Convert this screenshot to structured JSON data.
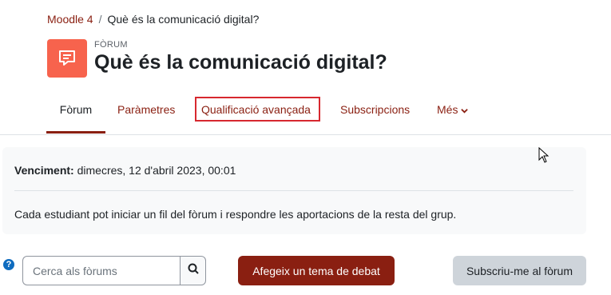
{
  "breadcrumb": {
    "home": "Moodle 4",
    "separator": "/",
    "current": "Què és la comunicació digital?"
  },
  "header": {
    "kicker": "FÒRUM",
    "title": "Què és la comunicació digital?",
    "icon": "forum-icon"
  },
  "tabs": [
    {
      "label": "Fòrum",
      "active": true
    },
    {
      "label": "Paràmetres",
      "active": false
    },
    {
      "label": "Qualificació avançada",
      "active": false,
      "highlighted": true
    },
    {
      "label": "Subscripcions",
      "active": false
    },
    {
      "label": "Més",
      "active": false,
      "dropdown": true
    }
  ],
  "info": {
    "due_label": "Venciment:",
    "due_value": "dimecres, 12 d'abril 2023, 00:01",
    "description": "Cada estudiant pot iniciar un fil del fòrum i respondre les aportacions de la resta del grup."
  },
  "actions": {
    "search_placeholder": "Cerca als fòrums",
    "add_topic": "Afegeix un tema de debat",
    "subscribe": "Subscriu-me al fòrum"
  },
  "colors": {
    "brand": "#8a1f11",
    "forum_icon_bg": "#f7634d",
    "highlight": "#d7282f",
    "help": "#0f6cbf"
  }
}
